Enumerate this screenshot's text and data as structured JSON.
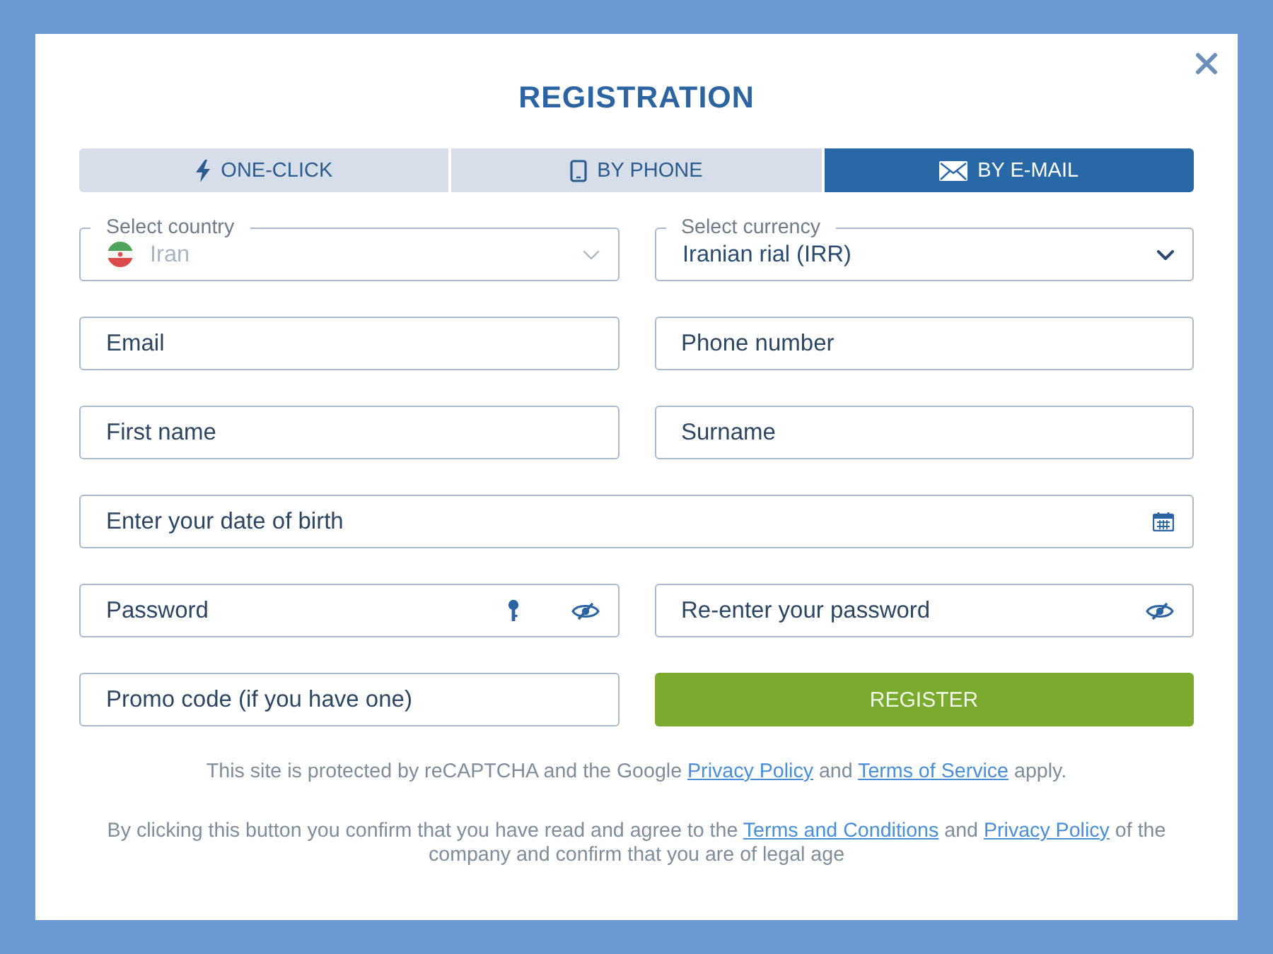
{
  "dialog": {
    "title": "REGISTRATION"
  },
  "tabs": [
    {
      "label": "ONE-CLICK",
      "selected": false
    },
    {
      "label": "BY PHONE",
      "selected": false
    },
    {
      "label": "BY E-MAIL",
      "selected": true
    }
  ],
  "form_rows": [
    [
      {
        "kind": "country",
        "label": "Select country",
        "value": "Iran",
        "disabled": true
      },
      {
        "kind": "select",
        "label": "Select currency",
        "value": "Iranian rial (IRR)",
        "disabled": false
      }
    ],
    [
      {
        "kind": "text",
        "placeholder": "Email"
      },
      {
        "kind": "text",
        "placeholder": "Phone number"
      }
    ],
    [
      {
        "kind": "text",
        "placeholder": "First name"
      },
      {
        "kind": "text",
        "placeholder": "Surname"
      }
    ],
    [
      {
        "kind": "date",
        "placeholder": "Enter your date of birth"
      }
    ],
    [
      {
        "kind": "password",
        "placeholder": "Password"
      },
      {
        "kind": "confirm",
        "placeholder": "Re-enter your password"
      }
    ],
    [
      {
        "kind": "text",
        "placeholder": "Promo code (if you have one)"
      },
      {
        "kind": "button",
        "label": "REGISTER"
      }
    ]
  ],
  "notices": [
    {
      "parts": [
        {
          "kind": "text",
          "text": "This site is protected by reCAPTCHA and the Google "
        },
        {
          "kind": "link",
          "text": "Privacy Policy"
        },
        {
          "kind": "text",
          "text": " and "
        },
        {
          "kind": "link",
          "text": "Terms of Service"
        },
        {
          "kind": "text",
          "text": " apply."
        }
      ]
    },
    {
      "parts": [
        {
          "kind": "text",
          "text": "By clicking this button you confirm that you have read and agree to the "
        },
        {
          "kind": "link",
          "text": "Terms and Conditions"
        },
        {
          "kind": "text",
          "text": " and "
        },
        {
          "kind": "link",
          "text": "Privacy Policy"
        },
        {
          "kind": "text",
          "text": " of the company and confirm that you are of legal age"
        }
      ]
    }
  ]
}
